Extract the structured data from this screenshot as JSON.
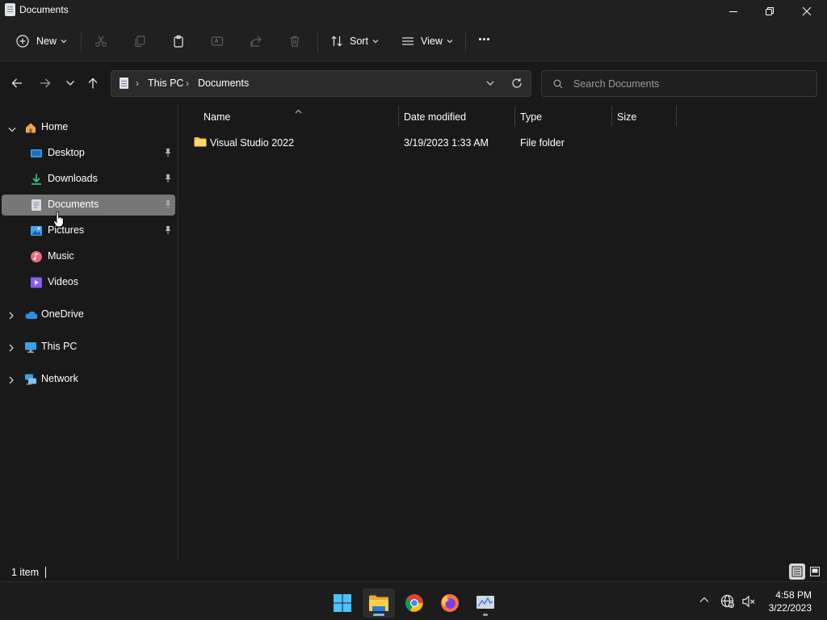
{
  "window": {
    "title": "Documents",
    "controls": {
      "minimize": "minimize",
      "maximize": "restore",
      "close": "close"
    }
  },
  "commandbar": {
    "new_label": "New",
    "sort_label": "Sort",
    "view_label": "View",
    "more_label": "···"
  },
  "address": {
    "crumbs": [
      "This PC",
      "Documents"
    ],
    "search_placeholder": "Search Documents"
  },
  "sidebar": {
    "home": "Home",
    "quick_access": [
      {
        "label": "Desktop",
        "icon": "desktop-icon",
        "pinned": true
      },
      {
        "label": "Downloads",
        "icon": "download-icon",
        "pinned": true
      },
      {
        "label": "Documents",
        "icon": "document-icon",
        "pinned": true,
        "selected": true
      },
      {
        "label": "Pictures",
        "icon": "pictures-icon",
        "pinned": true
      },
      {
        "label": "Music",
        "icon": "music-icon",
        "pinned": false
      },
      {
        "label": "Videos",
        "icon": "videos-icon",
        "pinned": false
      }
    ],
    "roots": [
      {
        "label": "OneDrive",
        "icon": "onedrive-icon"
      },
      {
        "label": "This PC",
        "icon": "pc-icon"
      },
      {
        "label": "Network",
        "icon": "network-icon"
      }
    ]
  },
  "columns": {
    "name": "Name",
    "date": "Date modified",
    "type": "Type",
    "size": "Size"
  },
  "files": [
    {
      "name": "Visual Studio 2022",
      "date": "3/19/2023 1:33 AM",
      "type": "File folder",
      "size": ""
    }
  ],
  "status": {
    "count": "1 item"
  },
  "taskbar": {
    "apps": [
      "start-icon",
      "file-explorer-icon",
      "chrome-icon",
      "firefox-icon",
      "task-manager-icon"
    ],
    "time": "4:58 PM",
    "date": "3/22/2023"
  },
  "colors": {
    "background": "#191919",
    "chrome": "#202020",
    "selected": "#777777",
    "folder": "#f4c04d",
    "accent": "#7eb9f0"
  }
}
